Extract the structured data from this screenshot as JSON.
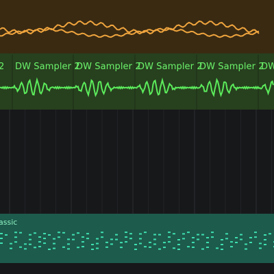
{
  "tracks": [
    {
      "id": "orange-track",
      "color": "#f0a53e",
      "clips": []
    },
    {
      "id": "green-sampler-track",
      "color": "#5cec5c",
      "clips": [
        {
          "label": "2"
        },
        {
          "label": "DW Sampler 2"
        },
        {
          "label": "DW Sampler 2"
        },
        {
          "label": "DW Sampler 2"
        },
        {
          "label": "DW Sampler 2"
        },
        {
          "label": "DW"
        }
      ]
    },
    {
      "id": "teal-track",
      "color": "#3fe0b2",
      "clips": [
        {
          "label": "assic"
        }
      ]
    }
  ],
  "colors": {
    "background": "#17181a",
    "orange_lane": "#3a2a12",
    "green_lane": "#27401e",
    "teal_lane": "#1d5b4c"
  }
}
